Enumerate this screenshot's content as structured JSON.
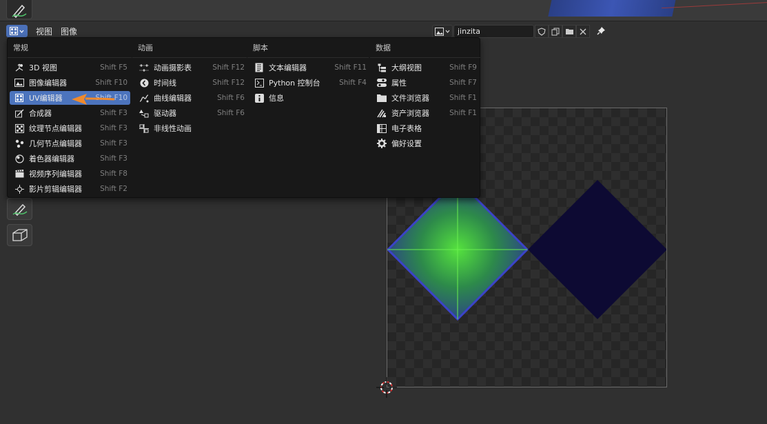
{
  "header": {
    "menu_view": "视图",
    "menu_image": "图像",
    "image_name": "jinzita"
  },
  "menu": {
    "columns": [
      {
        "title": "常规",
        "items": [
          {
            "label": "3D 视图",
            "shortcut": "Shift F5",
            "icon": "3d-view-icon"
          },
          {
            "label": "图像编辑器",
            "shortcut": "Shift F10",
            "icon": "image-editor-icon"
          },
          {
            "label": "UV编辑器",
            "shortcut": "Shift F10",
            "icon": "uv-editor-icon",
            "active": true
          },
          {
            "label": "合成器",
            "shortcut": "Shift F3",
            "icon": "compositor-icon"
          },
          {
            "label": "纹理节点编辑器",
            "shortcut": "Shift F3",
            "icon": "texture-node-icon"
          },
          {
            "label": "几何节点编辑器",
            "shortcut": "Shift F3",
            "icon": "geometry-node-icon"
          },
          {
            "label": "着色器编辑器",
            "shortcut": "Shift F3",
            "icon": "shader-editor-icon"
          },
          {
            "label": "视频序列编辑器",
            "shortcut": "Shift F8",
            "icon": "sequencer-icon"
          },
          {
            "label": "影片剪辑编辑器",
            "shortcut": "Shift F2",
            "icon": "clip-editor-icon"
          }
        ]
      },
      {
        "title": "动画",
        "items": [
          {
            "label": "动画摄影表",
            "shortcut": "Shift F12",
            "icon": "dopesheet-icon"
          },
          {
            "label": "时间线",
            "shortcut": "Shift F12",
            "icon": "timeline-icon"
          },
          {
            "label": "曲线编辑器",
            "shortcut": "Shift F6",
            "icon": "graph-editor-icon"
          },
          {
            "label": "驱动器",
            "shortcut": "Shift F6",
            "icon": "drivers-icon"
          },
          {
            "label": "非线性动画",
            "shortcut": "",
            "icon": "nla-icon"
          }
        ]
      },
      {
        "title": "脚本",
        "items": [
          {
            "label": "文本编辑器",
            "shortcut": "Shift F11",
            "icon": "text-editor-icon"
          },
          {
            "label": "Python 控制台",
            "shortcut": "Shift F4",
            "icon": "python-console-icon"
          },
          {
            "label": "信息",
            "shortcut": "",
            "icon": "info-icon"
          }
        ]
      },
      {
        "title": "数据",
        "items": [
          {
            "label": "大纲视图",
            "shortcut": "Shift F9",
            "icon": "outliner-icon"
          },
          {
            "label": "属性",
            "shortcut": "Shift F7",
            "icon": "properties-icon"
          },
          {
            "label": "文件浏览器",
            "shortcut": "Shift F1",
            "icon": "file-browser-icon"
          },
          {
            "label": "资产浏览器",
            "shortcut": "Shift F1",
            "icon": "asset-browser-icon"
          },
          {
            "label": "电子表格",
            "shortcut": "",
            "icon": "spreadsheet-icon"
          },
          {
            "label": "偏好设置",
            "shortcut": "",
            "icon": "preferences-icon"
          }
        ]
      }
    ]
  },
  "colors": {
    "accent": "#4c74bd",
    "arrow": "#f08a2c",
    "pyramid_center": "#4dd83a",
    "pyramid_edge": "#3a3fb0",
    "dark_diamond": "#0e0b35"
  }
}
